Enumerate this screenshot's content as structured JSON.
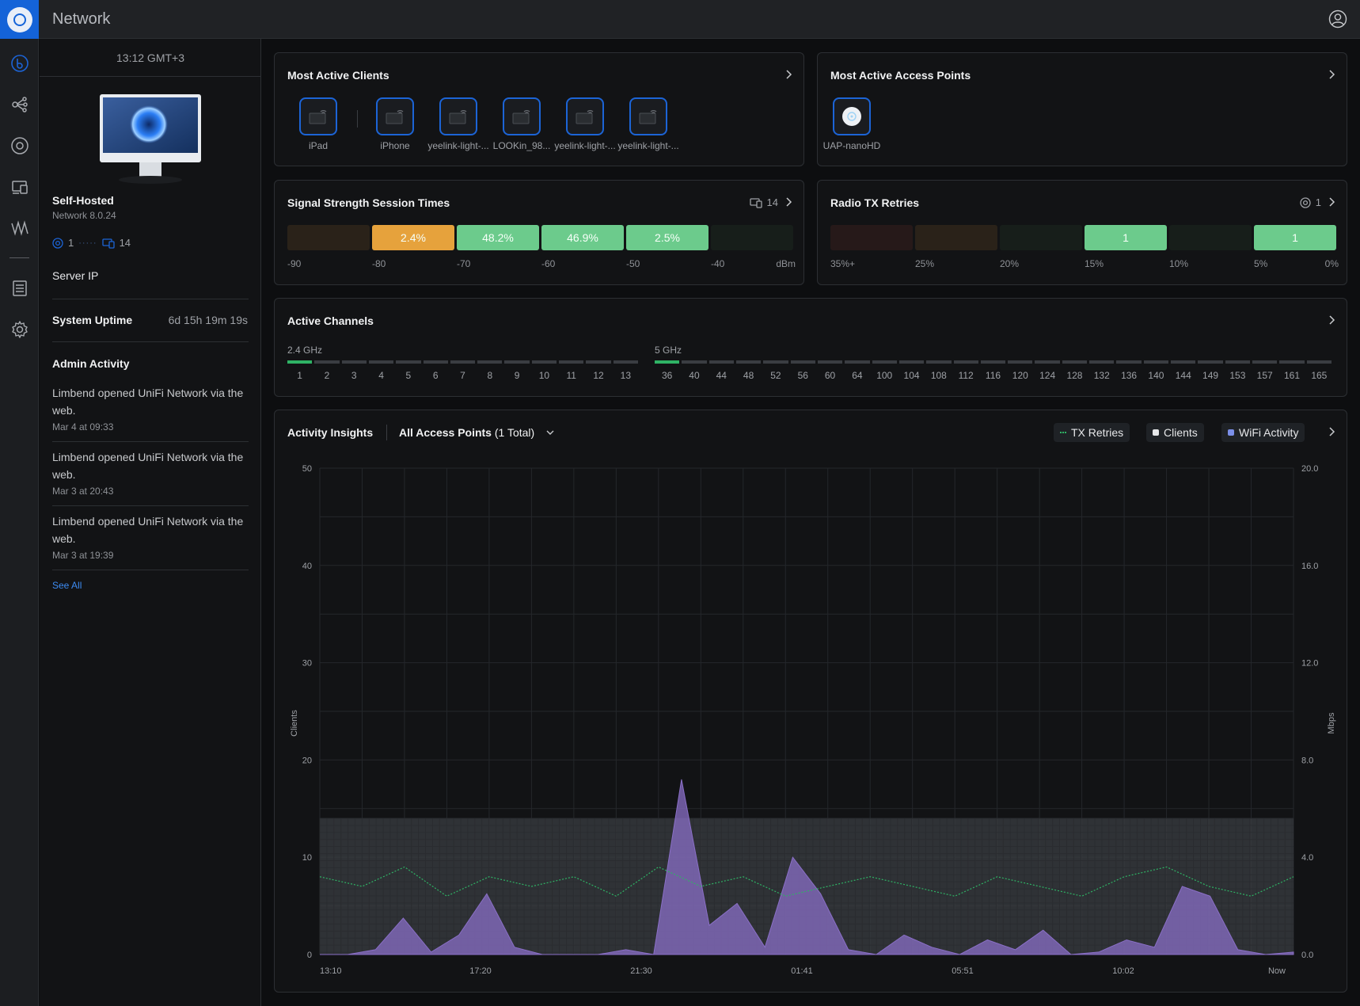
{
  "app": {
    "title": "Network"
  },
  "left": {
    "time": "13:12 GMT+3",
    "name": "Self-Hosted",
    "version": "Network 8.0.24",
    "ap_count": "1",
    "client_count": "14",
    "server_ip_label": "Server IP",
    "uptime_label": "System Uptime",
    "uptime_value": "6d 15h 19m 19s",
    "admin_title": "Admin Activity",
    "activity": [
      {
        "text": "Limbend opened UniFi Network via the web.",
        "when": "Mar 4 at 09:33"
      },
      {
        "text": "Limbend opened UniFi Network via the web.",
        "when": "Mar 3 at 20:43"
      },
      {
        "text": "Limbend opened UniFi Network via the web.",
        "when": "Mar 3 at 19:39"
      }
    ],
    "see_all": "See All"
  },
  "clients_card": {
    "title": "Most Active Clients",
    "clients": [
      "iPad",
      "iPhone",
      "yeelink-light-...",
      "LOOKin_98...",
      "yeelink-light-...",
      "yeelink-light-..."
    ]
  },
  "ap_card": {
    "title": "Most Active Access Points",
    "aps": [
      "UAP-nanoHD"
    ]
  },
  "signal_card": {
    "title": "Signal Strength Session Times",
    "count": "14",
    "bars": [
      {
        "value": "",
        "color": "#2a2219"
      },
      {
        "value": "2.4%",
        "color": "#e6a23c"
      },
      {
        "value": "48.2%",
        "color": "#6ccb8c"
      },
      {
        "value": "46.9%",
        "color": "#6ccb8c"
      },
      {
        "value": "2.5%",
        "color": "#6ccb8c"
      },
      {
        "value": "",
        "color": "#171e1a"
      }
    ],
    "ticks": [
      "-90",
      "-80",
      "-70",
      "-60",
      "-50",
      "-40",
      "dBm"
    ]
  },
  "radio_card": {
    "title": "Radio TX Retries",
    "count": "1",
    "bars": [
      {
        "value": "",
        "color": "#261919"
      },
      {
        "value": "",
        "color": "#2a2219"
      },
      {
        "value": "",
        "color": "#171e1a"
      },
      {
        "value": "1",
        "color": "#6ccb8c"
      },
      {
        "value": "",
        "color": "#171e1a"
      },
      {
        "value": "1",
        "color": "#6ccb8c"
      }
    ],
    "ticks": [
      "35%+",
      "25%",
      "20%",
      "15%",
      "10%",
      "5%",
      "0%"
    ]
  },
  "channels_card": {
    "title": "Active Channels",
    "band24": {
      "label": "2.4 GHz",
      "channels": [
        "1",
        "2",
        "3",
        "4",
        "5",
        "6",
        "7",
        "8",
        "9",
        "10",
        "11",
        "12",
        "13"
      ],
      "active": [
        "1"
      ]
    },
    "band5": {
      "label": "5 GHz",
      "channels": [
        "36",
        "40",
        "44",
        "48",
        "52",
        "56",
        "60",
        "64",
        "100",
        "104",
        "108",
        "112",
        "116",
        "120",
        "124",
        "128",
        "132",
        "136",
        "140",
        "144",
        "149",
        "153",
        "157",
        "161",
        "165"
      ],
      "active": [
        "36"
      ]
    }
  },
  "insights_card": {
    "title": "Activity Insights",
    "selector_bold": "All Access Points",
    "selector_rest": " (1 Total)",
    "legend": [
      {
        "label": "TX Retries",
        "color": "#2fb365"
      },
      {
        "label": "Clients",
        "color": "#e6e7e9"
      },
      {
        "label": "WiFi Activity",
        "color": "#7b8fe8"
      }
    ]
  },
  "chart_data": {
    "type": "area",
    "ylabel_left": "Clients",
    "ylabel_right": "Mbps",
    "y_left_ticks": [
      "50",
      "40",
      "30",
      "20",
      "10",
      "0"
    ],
    "y_right_ticks": [
      "20.0",
      "16.0",
      "12.0",
      "8.0",
      "4.0",
      "0.0"
    ],
    "ylim_left": [
      0,
      50
    ],
    "ylim_right": [
      0,
      20
    ],
    "x_ticks": [
      "13:10",
      "17:20",
      "21:30",
      "01:41",
      "05:51",
      "10:02",
      "Now"
    ],
    "series": [
      {
        "name": "Clients",
        "values": [
          14,
          14,
          14,
          14,
          14,
          14,
          14
        ]
      },
      {
        "name": "TX Retries",
        "values": [
          8,
          7,
          9,
          6,
          8,
          7,
          8,
          6,
          9,
          7,
          8,
          6,
          7,
          8,
          7,
          6,
          8,
          7,
          6,
          8,
          9,
          7,
          6,
          8
        ]
      },
      {
        "name": "WiFi Activity",
        "values": [
          0,
          0,
          0.2,
          1.5,
          0.1,
          0.8,
          2.5,
          0.3,
          0,
          0,
          0,
          0.2,
          0,
          7.2,
          1.2,
          2.1,
          0.3,
          4.0,
          2.5,
          0.2,
          0,
          0.8,
          0.3,
          0,
          0.6,
          0.2,
          1.0,
          0,
          0.1,
          0.6,
          0.3,
          2.8,
          2.4,
          0.2,
          0,
          0.1
        ]
      }
    ],
    "grid": true
  }
}
